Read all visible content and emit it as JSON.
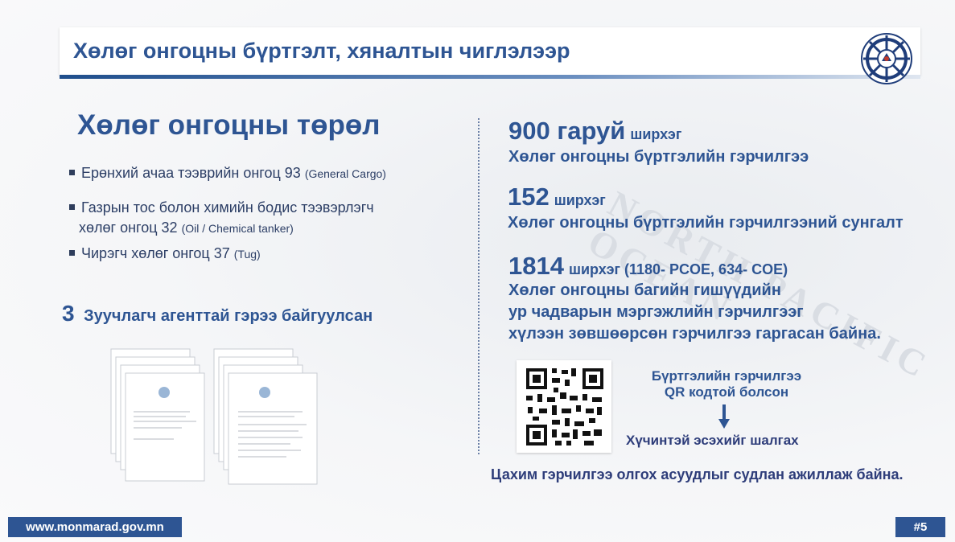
{
  "slide": {
    "title": "Хөлөг онгоцны бүртгэлт, хяналтын чиглэлээр",
    "logo_icon": "ship-wheel-emblem-icon",
    "page_number": "#5",
    "website": "www.monmarad.gov.mn"
  },
  "left": {
    "heading": "Хөлөг онгоцны төрөл",
    "items": [
      {
        "text": "Ерөнхий ачаа тээврийн онгоц 93",
        "note": "(General Cargo)"
      },
      {
        "text_line1": "Газрын тос болон химийн бодис  тээвэрлэгч",
        "text_line2": "хөлөг онгоц 32",
        "note": "(Oil / Chemical tanker)"
      },
      {
        "text": "Чирэгч хөлөг онгоц 37",
        "note": "(Tug)"
      }
    ],
    "agent_number": "3",
    "agent_text": "Зуучлагч агенттай гэрээ байгуулсан"
  },
  "right": {
    "stats": [
      {
        "value": "900 гаруй",
        "unit": "ширхэг",
        "description": "Хөлөг онгоцны бүртгэлийн гэрчилгээ"
      },
      {
        "value": "152",
        "unit": "ширхэг",
        "description": "Хөлөг онгоцны бүртгэлийн гэрчилгээний сунгалт"
      },
      {
        "value": "1814",
        "unit": "ширхэг (1180- PCOE, 634- COE)",
        "description_lines": [
          "Хөлөг онгоцны багийн гишүүдийн",
          "ур чадварын мэргэжлийн гэрчилгээг",
          "хүлээн зөвшөөрсөн гэрчилгээ гаргасан байна."
        ]
      }
    ],
    "qr": {
      "label_line1": "Бүртгэлийн гэрчилгээ",
      "label_line2": "QR кодтой болсон",
      "check_text": "Хүчинтэй эсэхийг шалгах"
    },
    "note": "Цахим гэрчилгээ олгох асуудлыг судлан ажиллаж байна."
  },
  "colors": {
    "primary": "#2e5593",
    "text_dark": "#2d3f66",
    "footer_bg": "#2e5593"
  }
}
